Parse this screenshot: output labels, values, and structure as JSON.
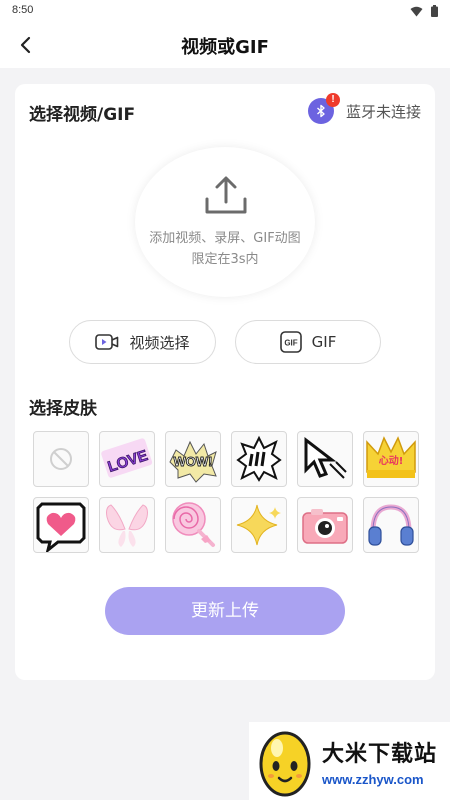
{
  "status_bar": {
    "time": "8:50"
  },
  "header": {
    "title": "视频或GIF"
  },
  "select_section": {
    "title": "选择视频/GIF",
    "bluetooth_status": "蓝牙未连接",
    "bluetooth_alert": "!",
    "upload_hint_line1": "添加视频、录屏、GIF动图",
    "upload_hint_line2": "限定在3s内",
    "video_button_label": "视频选择",
    "gif_button_label": "GIF",
    "gif_icon_text": "GIF"
  },
  "skin_section": {
    "title": "选择皮肤",
    "skins": [
      {
        "name": "none",
        "icon": "no-skin-icon"
      },
      {
        "name": "love",
        "icon": "love-sticker-icon",
        "text": "LOVE"
      },
      {
        "name": "wow",
        "icon": "wow-sticker-icon",
        "text": "WOW!"
      },
      {
        "name": "bubble",
        "icon": "comic-burst-icon"
      },
      {
        "name": "cursor",
        "icon": "pixel-cursor-icon"
      },
      {
        "name": "crown",
        "icon": "crown-sticker-icon",
        "text": "心动!"
      },
      {
        "name": "heart-bubble",
        "icon": "pixel-heart-bubble-icon"
      },
      {
        "name": "wings",
        "icon": "angel-wings-icon"
      },
      {
        "name": "lollipop",
        "icon": "lollipop-icon"
      },
      {
        "name": "sparkle",
        "icon": "sparkle-star-icon"
      },
      {
        "name": "camera",
        "icon": "pink-camera-icon"
      },
      {
        "name": "headphones",
        "icon": "headphones-icon"
      }
    ]
  },
  "actions": {
    "update_button": "更新上传"
  },
  "watermark": {
    "title": "大米下载站",
    "url": "www.zzhyw.com"
  },
  "colors": {
    "accent": "#aaa2f1",
    "bluetooth": "#6c63e0",
    "alert": "#ef3b2c"
  }
}
